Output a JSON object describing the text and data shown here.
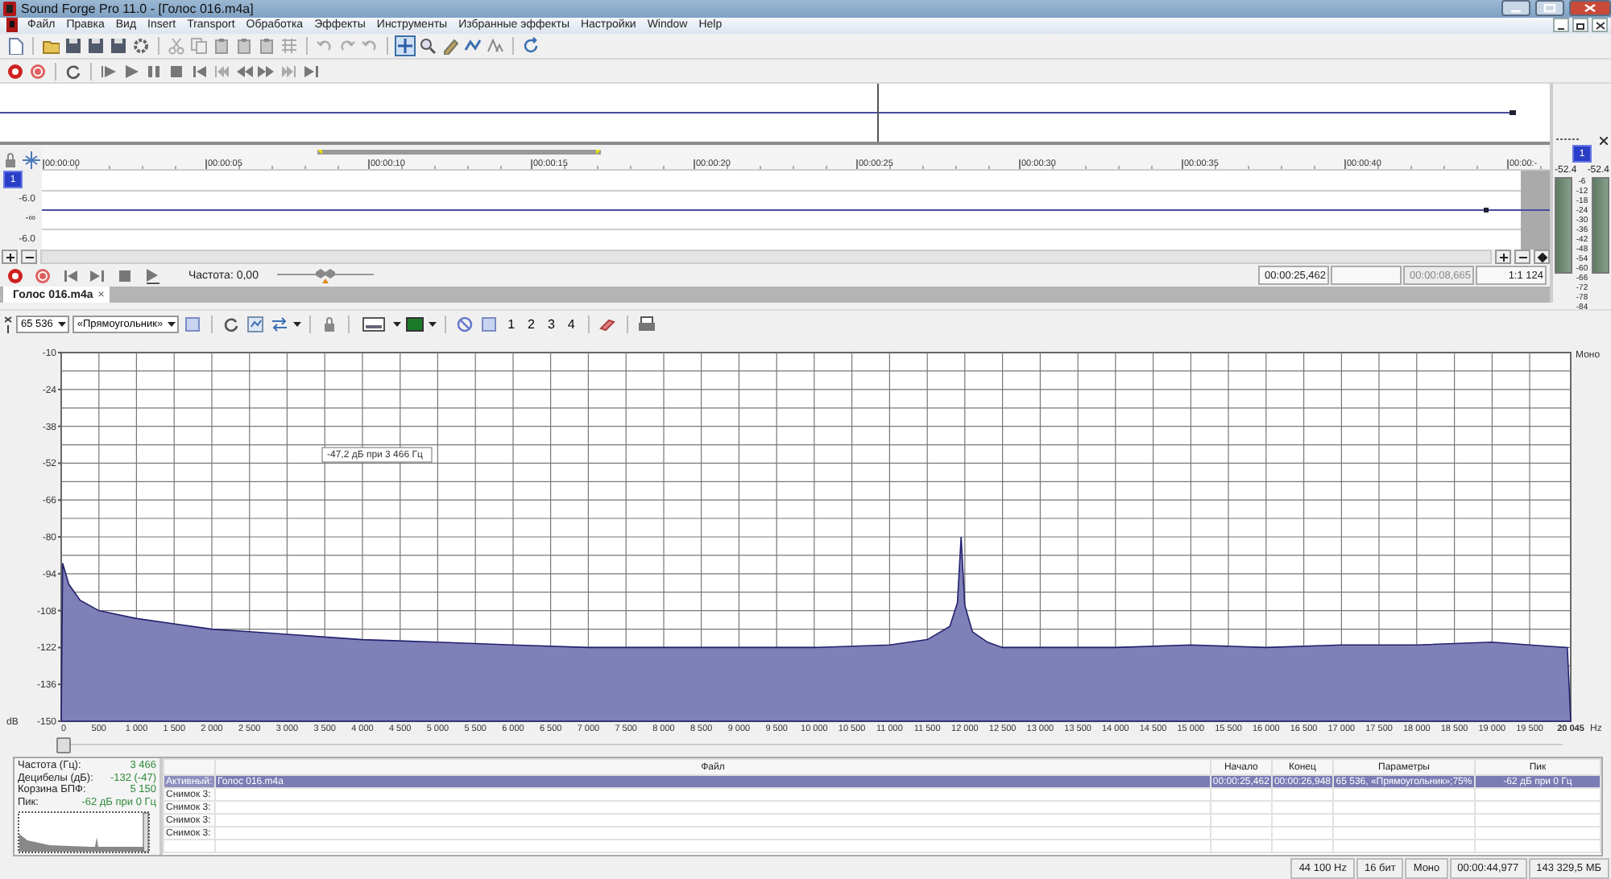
{
  "window": {
    "title": "Sound Forge Pro 11.0 - [Голос 016.m4a]"
  },
  "menu": [
    "Файл",
    "Правка",
    "Вид",
    "Insert",
    "Transport",
    "Обработка",
    "Эффекты",
    "Инструменты",
    "Избранные эффекты",
    "Настройки",
    "Window",
    "Help"
  ],
  "edit_tools": [
    {
      "kind": "cursor",
      "selected": true
    },
    {
      "kind": "magnifier",
      "selected": false
    },
    {
      "kind": "pencil",
      "selected": false
    },
    {
      "kind": "envelope",
      "selected": false
    },
    {
      "kind": "event",
      "selected": false
    }
  ],
  "timeline": {
    "ruler": [
      "00:00:00",
      "00:00:05",
      "00:00:10",
      "00:00:15",
      "00:00:20",
      "00:00:25",
      "00:00:30",
      "00:00:35",
      "00:00:40",
      "00:00:-"
    ],
    "track_number": "1",
    "scale": [
      "-6.0",
      "-∞",
      "-6.0"
    ]
  },
  "transport": {
    "frequency": "Частота: 0,00",
    "frequency_slider": {
      "level": 0.5
    },
    "fields": [
      {
        "value": "00:00:25,462",
        "disabled": false
      },
      {
        "disabled": false
      },
      {
        "value": "00:00:08,665",
        "disabled": true
      },
      {
        "value": "1:1 124",
        "disabled": false
      }
    ]
  },
  "document_tab": {
    "label": "Голос 016.m4a",
    "close": "×"
  },
  "meter": {
    "channel": "1",
    "peaks": [
      "-52.4",
      "-52.4"
    ],
    "scale": [
      "-6",
      "-12",
      "-18",
      "-24",
      "-30",
      "-36",
      "-42",
      "-48",
      "-54",
      "-60",
      "-66",
      "-72",
      "-78",
      "-84"
    ]
  },
  "spectrum": {
    "fft_size": "65 536",
    "window_type": "«Прямоугольник»",
    "snapshots": [
      "1",
      "2",
      "3",
      "4"
    ],
    "channel_label": "Моно",
    "scroll": {
      "level": 0
    },
    "chart_data": {
      "type": "area",
      "xlabel": "Hz",
      "ylabel": "dB",
      "grid": true,
      "x": [
        0,
        20,
        100,
        250,
        500,
        1000,
        1500,
        2000,
        2500,
        3000,
        3500,
        4000,
        5000,
        6000,
        7000,
        8000,
        9000,
        10000,
        11000,
        11500,
        11800,
        11900,
        11950,
        12000,
        12100,
        12300,
        12500,
        13000,
        14000,
        15000,
        16000,
        17000,
        18000,
        19000,
        19500,
        20000,
        20045
      ],
      "series": [
        {
          "color": "#8080b8",
          "values": [
            -150,
            -90,
            -98,
            -104,
            -108,
            -111,
            -113,
            -115,
            -116,
            -117,
            -118,
            -119,
            -120,
            -121,
            -122,
            -122,
            -122,
            -122,
            -121,
            -119,
            -114,
            -105,
            -80,
            -106,
            -116,
            -120,
            -122,
            -122,
            -122,
            -121,
            -122,
            -121,
            -121,
            -120,
            -121,
            -122,
            -150
          ]
        }
      ],
      "xlim": [
        0,
        20045
      ],
      "ylim": [
        -150,
        -10
      ],
      "xticks": [
        0,
        500,
        {
          "value": 1000,
          "label": "1 000"
        },
        {
          "value": 1500,
          "label": "1 500"
        },
        {
          "value": 2000,
          "label": "2 000"
        },
        {
          "value": 2500,
          "label": "2 500"
        },
        {
          "value": 3000,
          "label": "3 000"
        },
        {
          "value": 3500,
          "label": "3 500"
        },
        {
          "value": 4000,
          "label": "4 000"
        },
        {
          "value": 4500,
          "label": "4 500"
        },
        {
          "value": 5000,
          "label": "5 000"
        },
        {
          "value": 5500,
          "label": "5 500"
        },
        {
          "value": 6000,
          "label": "6 000"
        },
        {
          "value": 6500,
          "label": "6 500"
        },
        {
          "value": 7000,
          "label": "7 000"
        },
        {
          "value": 7500,
          "label": "7 500"
        },
        {
          "value": 8000,
          "label": "8 000"
        },
        {
          "value": 8500,
          "label": "8 500"
        },
        {
          "value": 9000,
          "label": "9 000"
        },
        {
          "value": 9500,
          "label": "9 500"
        },
        {
          "value": 10000,
          "label": "10 000"
        },
        {
          "value": 10500,
          "label": "10 500"
        },
        {
          "value": 11000,
          "label": "11 000"
        },
        {
          "value": 11500,
          "label": "11 500"
        },
        {
          "value": 12000,
          "label": "12 000"
        },
        {
          "value": 12500,
          "label": "12 500"
        },
        {
          "value": 13000,
          "label": "13 000"
        },
        {
          "value": 13500,
          "label": "13 500"
        },
        {
          "value": 14000,
          "label": "14 000"
        },
        {
          "value": 14500,
          "label": "14 500"
        },
        {
          "value": 15000,
          "label": "15 000"
        },
        {
          "value": 15500,
          "label": "15 500"
        },
        {
          "value": 16000,
          "label": "16 000"
        },
        {
          "value": 16500,
          "label": "16 500"
        },
        {
          "value": 17000,
          "label": "17 000"
        },
        {
          "value": 17500,
          "label": "17 500"
        },
        {
          "value": 18000,
          "label": "18 000"
        },
        {
          "value": 18500,
          "label": "18 500"
        },
        {
          "value": 19000,
          "label": "19 000"
        },
        {
          "value": 19500,
          "label": "19 500"
        },
        {
          "value": 20045,
          "label": "20 045"
        }
      ],
      "yticks": [
        -10,
        -24,
        -38,
        -52,
        -66,
        -80,
        -94,
        -108,
        -122,
        -136,
        -150
      ],
      "annotations": [
        "-47,2 дБ при 3 466 Гц"
      ]
    }
  },
  "info": [
    {
      "label": "Частота (Гц):",
      "value": "3 466"
    },
    {
      "label": "Децибелы (дБ):",
      "value": "-132 (-47)"
    },
    {
      "label": "Корзина БПФ:",
      "value": "5 150"
    },
    {
      "label": "Пик:",
      "value": "-62 дБ при 0 Гц"
    }
  ],
  "snapshot_table": {
    "columns": [
      "Файл",
      "Начало",
      "Конец",
      "Параметры",
      "Пик"
    ],
    "rows": [
      {
        "label": "Активный:",
        "cells": [
          "Голос 016.m4a",
          "00:00:25,462",
          "00:00:26,948",
          "65 536, «Прямоугольник»;75%",
          "-62 дБ при 0 Гц"
        ],
        "selected": true
      },
      {
        "label": "Снимок 3:",
        "selected": false
      },
      {
        "label": "Снимок 3:",
        "selected": false
      },
      {
        "label": "Снимок 3:",
        "selected": false
      },
      {
        "label": "Снимок 3:",
        "selected": false
      }
    ]
  },
  "status_bar": [
    "44 100 Hz",
    "16 бит",
    "Моно",
    "00:00:44,977",
    "143 329,5 МБ"
  ]
}
